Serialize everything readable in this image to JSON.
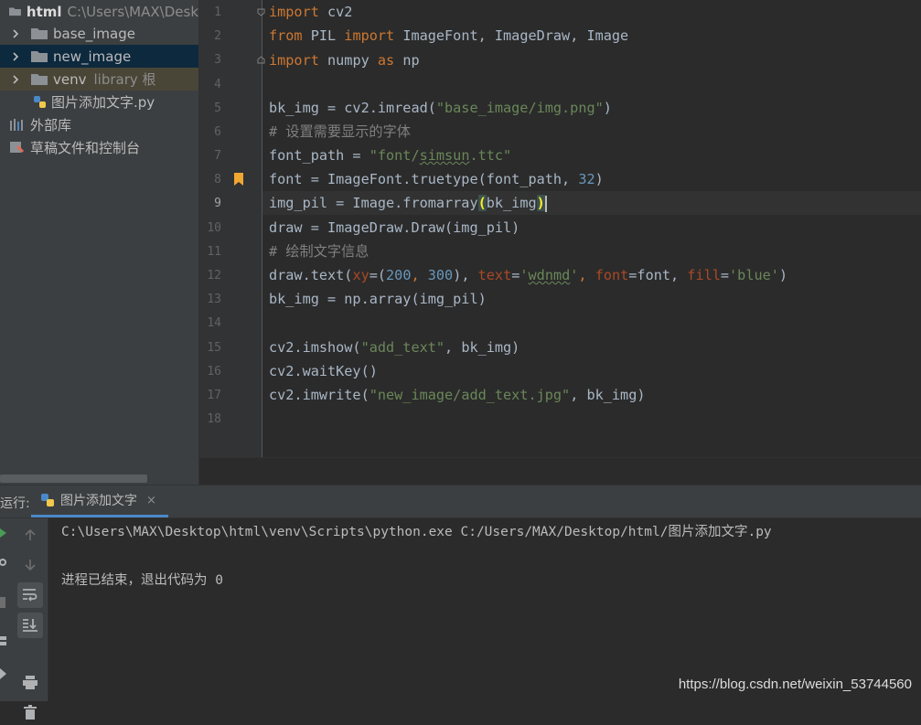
{
  "project": {
    "root": {
      "name": "html",
      "path": "C:\\Users\\MAX\\Desk"
    },
    "items": [
      {
        "label": "base_image",
        "type": "folder"
      },
      {
        "label": "new_image",
        "type": "folder"
      },
      {
        "label": "venv",
        "suffix": "library 根",
        "type": "folder"
      },
      {
        "label": "图片添加文字.py",
        "type": "python-file"
      },
      {
        "label": "外部库",
        "type": "library"
      },
      {
        "label": "草稿文件和控制台",
        "type": "scratch"
      }
    ]
  },
  "editor": {
    "line_numbers": [
      "1",
      "2",
      "3",
      "4",
      "5",
      "6",
      "7",
      "8",
      "9",
      "10",
      "11",
      "12",
      "13",
      "14",
      "15",
      "16",
      "17",
      "18"
    ],
    "current_line": "9"
  },
  "code": {
    "l1": {
      "kw": "import",
      "rest": " cv2"
    },
    "l2": {
      "kw1": "from",
      "mod": " PIL ",
      "kw2": "import",
      "rest": " ImageFont, ImageDraw, Image"
    },
    "l3": {
      "kw1": "import",
      "mod": " numpy ",
      "kw2": "as",
      "rest": " np"
    },
    "l5": {
      "a": "bk_img = cv2.imread(",
      "s": "\"base_image/img.png\"",
      "b": ")"
    },
    "l6": {
      "c": "# 设置需要显示的字体"
    },
    "l7": {
      "a": "font_path = ",
      "s1": "\"font/",
      "sq": "simsun",
      "s2": ".ttc\""
    },
    "l8": {
      "a": "font = ImageFont.truetype(font_path, ",
      "n": "32",
      "b": ")"
    },
    "l9": {
      "a": "img_pil = Image.fromarray",
      "p1": "(",
      "b": "bk_img",
      "p2": ")"
    },
    "l10": {
      "a": "draw = ImageDraw.Draw(img_pil)"
    },
    "l11": {
      "c": "# 绘制文字信息"
    },
    "l12": {
      "a": "draw.text(",
      "k1": "xy",
      "b": "=(",
      "n1": "200",
      "c": ", ",
      "n2": "300",
      "d": "), ",
      "k2": "text",
      "e": "=",
      "s1": "'",
      "sq": "wdnmd",
      "s2": "'",
      "f": ", ",
      "k3": "font",
      "g": "=font, ",
      "k4": "fill",
      "h": "=",
      "s3": "'blue'",
      "i": ")"
    },
    "l13": {
      "a": "bk_img = np.array(img_pil)"
    },
    "l15": {
      "a": "cv2.imshow(",
      "s": "\"add_text\"",
      "b": ", bk_img)"
    },
    "l16": {
      "a": "cv2.waitKey()"
    },
    "l17": {
      "a": "cv2.imwrite(",
      "s": "\"new_image/add_text.jpg\"",
      "b": ", bk_img)"
    }
  },
  "run": {
    "label": "运行:",
    "tab_label": "图片添加文字",
    "tab_close": "×",
    "console": [
      "C:\\Users\\MAX\\Desktop\\html\\venv\\Scripts\\python.exe C:/Users/MAX/Desktop/html/图片添加文字.py",
      "进程已结束，退出代码为 0"
    ]
  },
  "watermark": "https://blog.csdn.net/weixin_53744560",
  "colors": {
    "keyword": "#cc7832",
    "string": "#6a8759",
    "number": "#6897bb",
    "comment": "#808080",
    "param": "#aa4926",
    "text": "#a9b7c6"
  }
}
